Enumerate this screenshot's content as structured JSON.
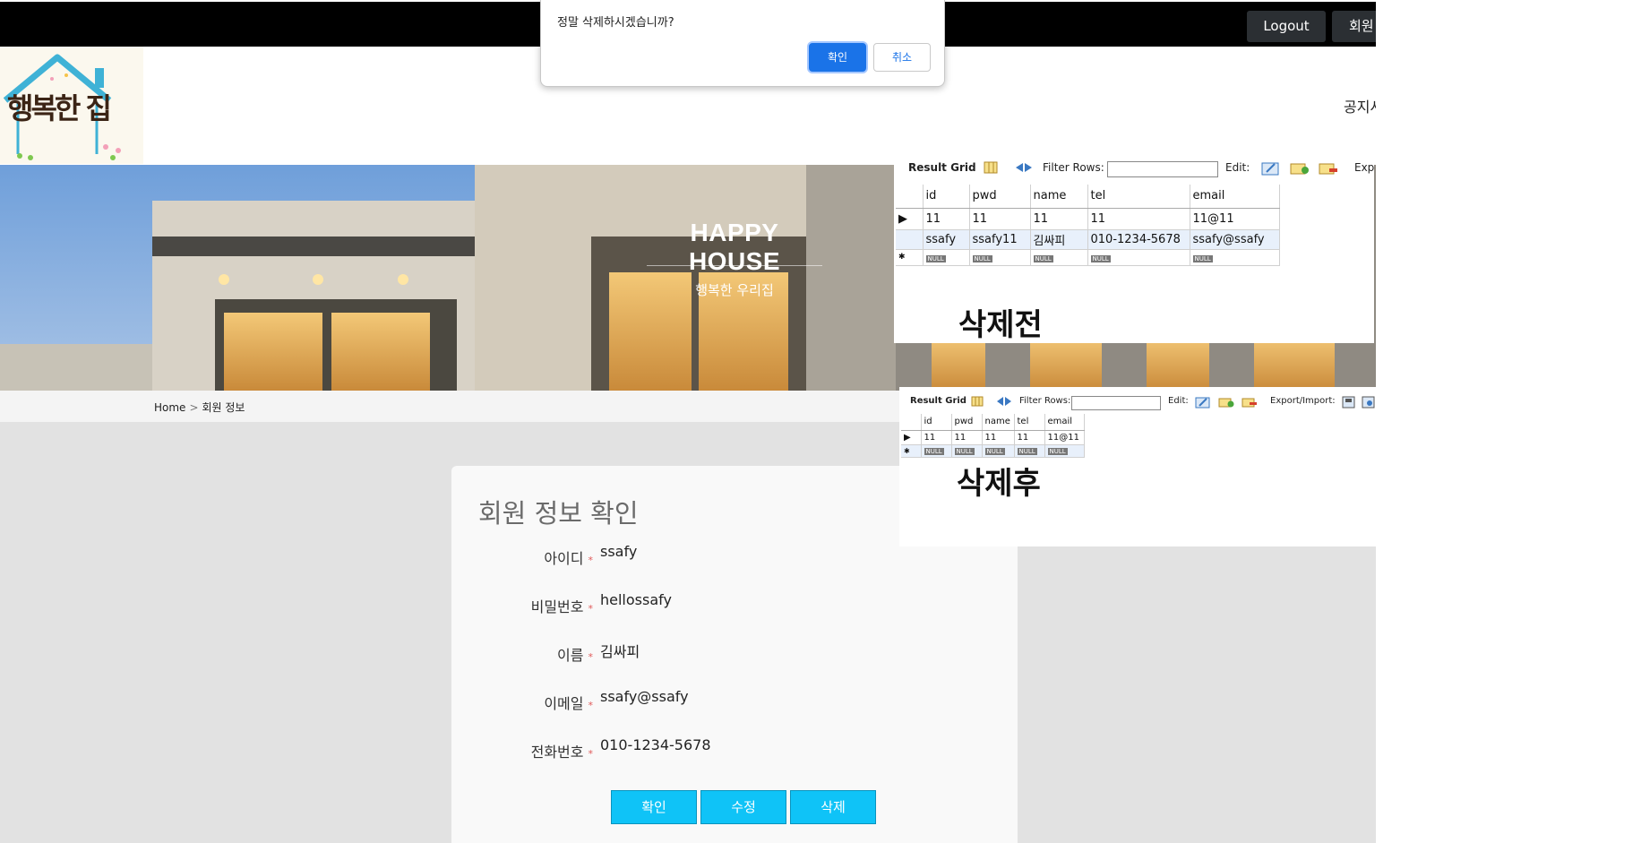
{
  "dialog": {
    "message": "정말 삭제하시겠습니까?",
    "ok_label": "확인",
    "cancel_label": "취소"
  },
  "topbar": {
    "logout_label": "Logout",
    "member_label": "회원"
  },
  "header": {
    "logo_text": "행복한 집",
    "nav_notice": "공지사"
  },
  "hero": {
    "title": "HAPPY HOUSE",
    "subtitle": "행복한 우리집"
  },
  "breadcrumb": {
    "home": "Home",
    "separator": ">",
    "current": "회원 정보"
  },
  "member_card": {
    "title": "회원 정보 확인",
    "required_mark": "*",
    "fields": [
      {
        "label": "아이디",
        "value": "ssafy"
      },
      {
        "label": "비밀번호",
        "value": "hellossafy"
      },
      {
        "label": "이름",
        "value": "김싸피"
      },
      {
        "label": "이메일",
        "value": "ssafy@ssafy"
      },
      {
        "label": "전화번호",
        "value": "010-1234-5678"
      }
    ],
    "buttons": {
      "confirm": "확인",
      "edit": "수정",
      "delete": "삭제"
    },
    "button_color": "#0fc3f7"
  },
  "db_before": {
    "toolbar": {
      "result_grid": "Result Grid",
      "filter_rows": "Filter Rows:",
      "edit": "Edit:",
      "export": "Exp"
    },
    "columns": [
      "id",
      "pwd",
      "name",
      "tel",
      "email"
    ],
    "rows": [
      [
        "11",
        "11",
        "11",
        "11",
        "11@11"
      ],
      [
        "ssafy",
        "ssafy11",
        "김싸피",
        "010-1234-5678",
        "ssafy@ssafy"
      ]
    ],
    "null_label": "NULL",
    "caption": "삭제전"
  },
  "db_after": {
    "toolbar": {
      "result_grid": "Result Grid",
      "filter_rows": "Filter Rows:",
      "edit": "Edit:",
      "export": "Export/Import:"
    },
    "columns": [
      "id",
      "pwd",
      "name",
      "tel",
      "email"
    ],
    "rows": [
      [
        "11",
        "11",
        "11",
        "11",
        "11@11"
      ]
    ],
    "null_label": "NULL",
    "caption": "삭제후"
  }
}
